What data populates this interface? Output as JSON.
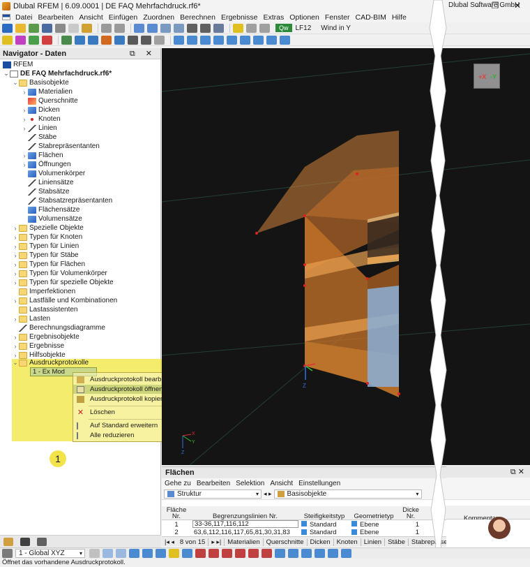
{
  "window": {
    "title": "Dlubal RFEM | 6.09.0001 | DE FAQ Mehrfachdruck.rf6*",
    "company": "Dlubal Software GmbH"
  },
  "menu": [
    "Datei",
    "Bearbeiten",
    "Ansicht",
    "Einfügen",
    "Zuordnen",
    "Berechnen",
    "Ergebnisse",
    "Extras",
    "Optionen",
    "Fenster",
    "CAD-BIM",
    "Hilfe"
  ],
  "loadcase": {
    "badge": "Qw",
    "code": "LF12",
    "name": "Wind in Y"
  },
  "navigator": {
    "title": "Navigator - Daten",
    "root": "RFEM",
    "file": "DE FAQ Mehrfachdruck.rf6*",
    "items": [
      "Basisobjekte",
      "Materialien",
      "Querschnitte",
      "Dicken",
      "Knoten",
      "Linien",
      "Stäbe",
      "Stabrepräsentanten",
      "Flächen",
      "Öffnungen",
      "Volumenkörper",
      "Liniensätze",
      "Stabsätze",
      "Stabsatzrepräsentanten",
      "Flächensätze",
      "Volumensätze",
      "Spezielle Objekte",
      "Typen für Knoten",
      "Typen für Linien",
      "Typen für Stäbe",
      "Typen für Flächen",
      "Typen für Volumenkörper",
      "Typen für spezielle Objekte",
      "Imperfektionen",
      "Lastfälle und Kombinationen",
      "Lastassistenten",
      "Lasten",
      "Berechnungsdiagramme",
      "Ergebnisobjekte",
      "Ergebnisse",
      "Hilfsobjekte",
      "Ausdruckprotokolle"
    ],
    "selected": "1 - Ex Mod"
  },
  "context_menu": {
    "items": [
      "Ausdruckprotokoll bearbeiten",
      "Ausdruckprotokoll öffnen",
      "Ausdruckprotokoll kopieren",
      "Löschen",
      "Auf Standard erweitern",
      "Alle reduzieren"
    ]
  },
  "callout": "1",
  "panel": {
    "title": "Flächen",
    "menu": [
      "Gehe zu",
      "Bearbeiten",
      "Selektion",
      "Ansicht",
      "Einstellungen"
    ],
    "filter1": "Struktur",
    "filter2": "Basisobjekte",
    "headers": {
      "nr": "Fläche\nNr.",
      "lines": "Begrenzungslinien Nr.",
      "stiff": "Steifigkeitstyp",
      "geom": "Geometrietyp",
      "thick": "Dicke\nNr.",
      "comment": "Kommentar"
    },
    "rows": [
      {
        "nr": "1",
        "lines": "33-36,117,116,112",
        "stiff": "Standard",
        "geom": "Ebene",
        "thick": "1"
      },
      {
        "nr": "2",
        "lines": "63,6,112,116,117,65,81,30,31,83",
        "stiff": "Standard",
        "geom": "Ebene",
        "thick": "1"
      }
    ],
    "pager": "8 von 15",
    "tabs": [
      "Materialien",
      "Querschnitte",
      "Dicken",
      "Knoten",
      "Linien",
      "Stäbe",
      "Stabrepräsentan"
    ]
  },
  "view": {
    "axis_x": "X",
    "axis_y": "Y",
    "axis_z": "Z",
    "cube_x": "+X",
    "cube_y": "-Y"
  },
  "bottom_toolbar": {
    "view_label": "1 - Global XYZ"
  },
  "status": "Öffnet das vorhandene Ausdruckprotokoll."
}
